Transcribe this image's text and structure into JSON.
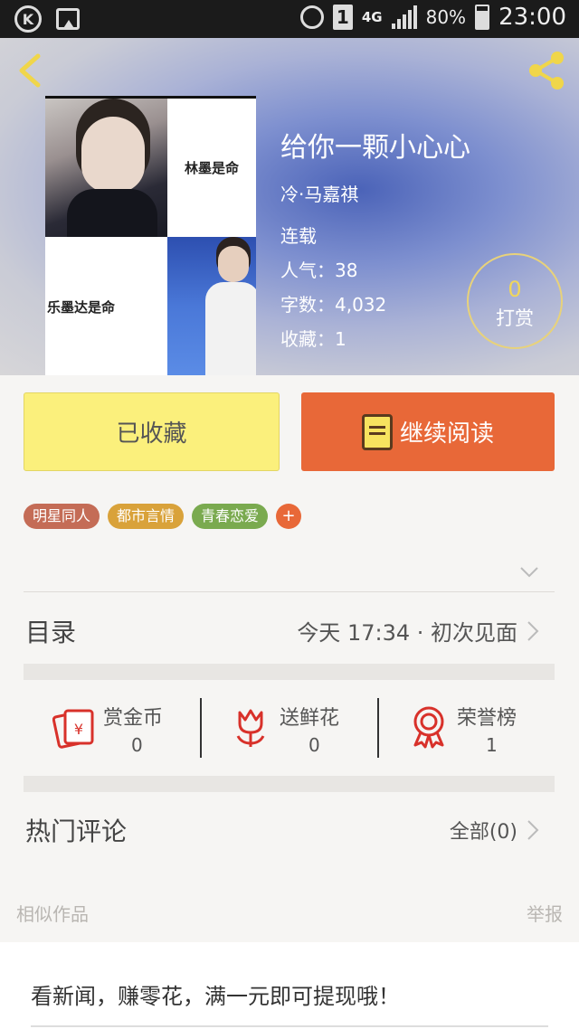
{
  "status_bar": {
    "battery_pct": "80%",
    "time": "23:00",
    "sim_slot": "1",
    "network": "4G"
  },
  "book": {
    "title": "给你一颗小心心",
    "author": "冷·马嘉祺",
    "status": "连载",
    "popularity": "人气：38",
    "word_count": "字数：4,032",
    "favorites": "收藏：1",
    "cover_text_1": "林墨是命",
    "cover_text_2": "乐墨达是命"
  },
  "reward": {
    "count": "0",
    "label": "打赏"
  },
  "actions": {
    "collected_label": "已收藏",
    "continue_label": "继续阅读"
  },
  "tags": [
    {
      "label": "明星同人",
      "color": "#c46c56"
    },
    {
      "label": "都市言情",
      "color": "#d9a23a"
    },
    {
      "label": "青春恋爱",
      "color": "#7aaa4f"
    }
  ],
  "tag_add_label": "+",
  "toc": {
    "label": "目录",
    "latest": "今天 17:34 · 初次见面"
  },
  "stats": [
    {
      "label": "赏金币",
      "value": "0",
      "icon": "red-envelope-icon"
    },
    {
      "label": "送鲜花",
      "value": "0",
      "icon": "flower-icon"
    },
    {
      "label": "荣誉榜",
      "value": "1",
      "icon": "medal-icon"
    }
  ],
  "comments": {
    "label": "热门评论",
    "all": "全部(0)"
  },
  "similar_label": "相似作品",
  "report_label": "举报",
  "news_banner": "看新闻，赚零花，满一元即可提现哦！",
  "colors": {
    "accent_orange": "#e86838",
    "collected_yellow": "#fbf07c",
    "icon_red": "#d8312a"
  }
}
